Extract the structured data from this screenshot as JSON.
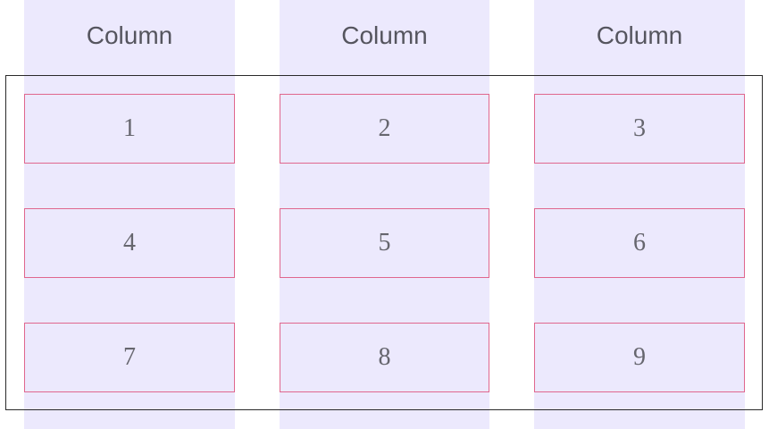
{
  "columns": [
    {
      "label": "Column"
    },
    {
      "label": "Column"
    },
    {
      "label": "Column"
    }
  ],
  "items": [
    "1",
    "2",
    "3",
    "4",
    "5",
    "6",
    "7",
    "8",
    "9"
  ],
  "colors": {
    "column_background": "#ece9fd",
    "item_border": "#e0678e",
    "container_border": "#2a2a2a",
    "text": "#55555e"
  }
}
